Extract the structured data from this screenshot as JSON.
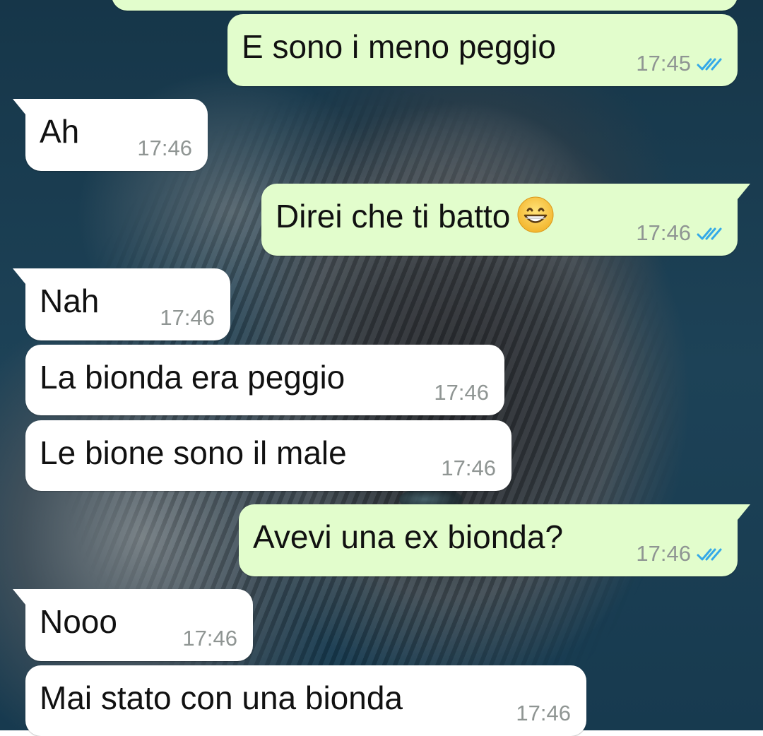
{
  "colors": {
    "incoming_bubble": "#ffffff",
    "outgoing_bubble": "#e2fdcc",
    "timestamp": "#8f9593",
    "read_ticks": "#34a9e8",
    "wallpaper_dark": "#163649"
  },
  "messages": [
    {
      "direction": "outgoing",
      "text": "E sono i meno peggio",
      "time": "17:45",
      "status_icon": "double-check-icon"
    },
    {
      "direction": "incoming",
      "text": "Ah",
      "time": "17:46"
    },
    {
      "direction": "outgoing",
      "text": "Direi che ti batto",
      "emoji": "grinning-face-icon",
      "time": "17:46",
      "status_icon": "double-check-icon"
    },
    {
      "direction": "incoming",
      "text": "Nah",
      "time": "17:46"
    },
    {
      "direction": "incoming",
      "text": "La bionda era peggio",
      "time": "17:46"
    },
    {
      "direction": "incoming",
      "text": "Le bione sono il male",
      "time": "17:46"
    },
    {
      "direction": "outgoing",
      "text": "Avevi una ex bionda?",
      "time": "17:46",
      "status_icon": "double-check-icon"
    },
    {
      "direction": "incoming",
      "text": "Nooo",
      "time": "17:46"
    },
    {
      "direction": "incoming",
      "text": "Mai stato con una bionda",
      "time": "17:46"
    }
  ]
}
